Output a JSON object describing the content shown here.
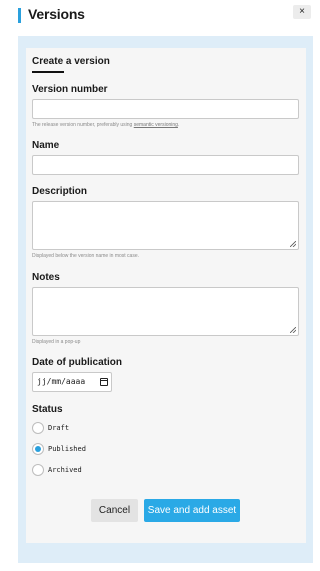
{
  "header": {
    "title": "Versions",
    "close_label": "×"
  },
  "tab": {
    "label": "Create a version"
  },
  "fields": {
    "version_number": {
      "label": "Version number",
      "value": "",
      "hint": "The release version number, preferably using ",
      "hint_link": "semantic versioning",
      "hint_end": "."
    },
    "name": {
      "label": "Name",
      "value": ""
    },
    "description": {
      "label": "Description",
      "value": "",
      "hint": "Displayed below the version name in most case."
    },
    "notes": {
      "label": "Notes",
      "value": "",
      "hint": "Displayed in a pop-up"
    },
    "date": {
      "label": "Date of publication",
      "placeholder": "jj/mm/aaaa"
    },
    "status": {
      "label": "Status",
      "options": [
        "Draft",
        "Published",
        "Archived"
      ],
      "selected": "Published"
    }
  },
  "buttons": {
    "cancel": "Cancel",
    "save": "Save and add asset"
  },
  "colors": {
    "accent": "#2aa0dd",
    "save_button": "#2aa9e6",
    "panel": "#deedf8"
  }
}
